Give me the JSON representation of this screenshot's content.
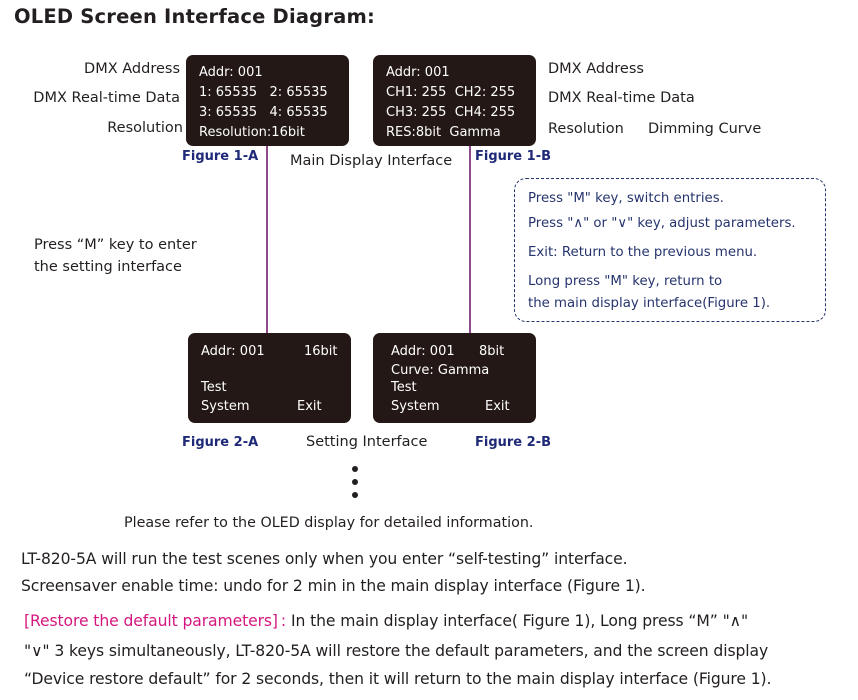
{
  "title": "OLED Screen Interface Diagram:",
  "main_display": {
    "caption": "Main Display Interface",
    "left_labels": [
      "DMX Address",
      "DMX Real-time Data",
      "Resolution"
    ],
    "right_labels": [
      "DMX Address",
      "DMX Real-time Data",
      "Resolution",
      "Dimming Curve"
    ],
    "figure_a": {
      "label": "Figure 1-A",
      "lines": [
        "Addr: 001",
        "1: 65535   2: 65535",
        "3: 65535   4: 65535",
        "Resolution:16bit"
      ]
    },
    "figure_b": {
      "label": "Figure 1-B",
      "lines": [
        "Addr: 001",
        "CH1: 255  CH2: 255",
        "CH3: 255  CH4: 255",
        "RES:8bit  Gamma"
      ]
    }
  },
  "enter_hint": [
    "Press “M” key to enter",
    "the setting interface"
  ],
  "notes": [
    "Press \"M\" key,  switch entries.",
    "Press \"∧\" or \"∨\" key,  adjust parameters.",
    "Exit: Return to the previous menu.",
    "Long press \"M\" key,  return to",
    "the main display interface(Figure 1)."
  ],
  "setting": {
    "caption": "Setting Interface",
    "figure_a": {
      "label": "Figure 2-A",
      "addr": "Addr: 001",
      "res": "16bit",
      "curve": "",
      "test": "Test",
      "system": "System",
      "exit": "Exit"
    },
    "figure_b": {
      "label": "Figure 2-B",
      "addr": "Addr: 001",
      "res": "8bit",
      "curve": "Curve: Gamma",
      "test": "Test",
      "system": "System",
      "exit": "Exit"
    }
  },
  "refer_note": "Please refer to the OLED display for detailed information.",
  "paragraphs": {
    "p1": "LT-820-5A will run the test scenes only when you enter “self-testing” interface.",
    "p2": "Screensaver enable time: undo for 2 min in the main display interface (Figure 1).",
    "restore_heading": "[Restore the default parameters] :",
    "restore_line1": " In the main display interface( Figure 1), Long press “M” \"∧\"",
    "restore_line2": "\"∨\" 3 keys simultaneously, LT-820-5A will restore the default parameters, and the screen display",
    "restore_line3": "“Device restore default” for 2 seconds, then it will return to the main display interface (Figure 1)."
  },
  "colors": {
    "oled_bg": "#231815",
    "figure_label": "#1e2a78",
    "connector": "#8e4a8a",
    "note_text": "#26346e",
    "highlight": "#d4177f"
  }
}
